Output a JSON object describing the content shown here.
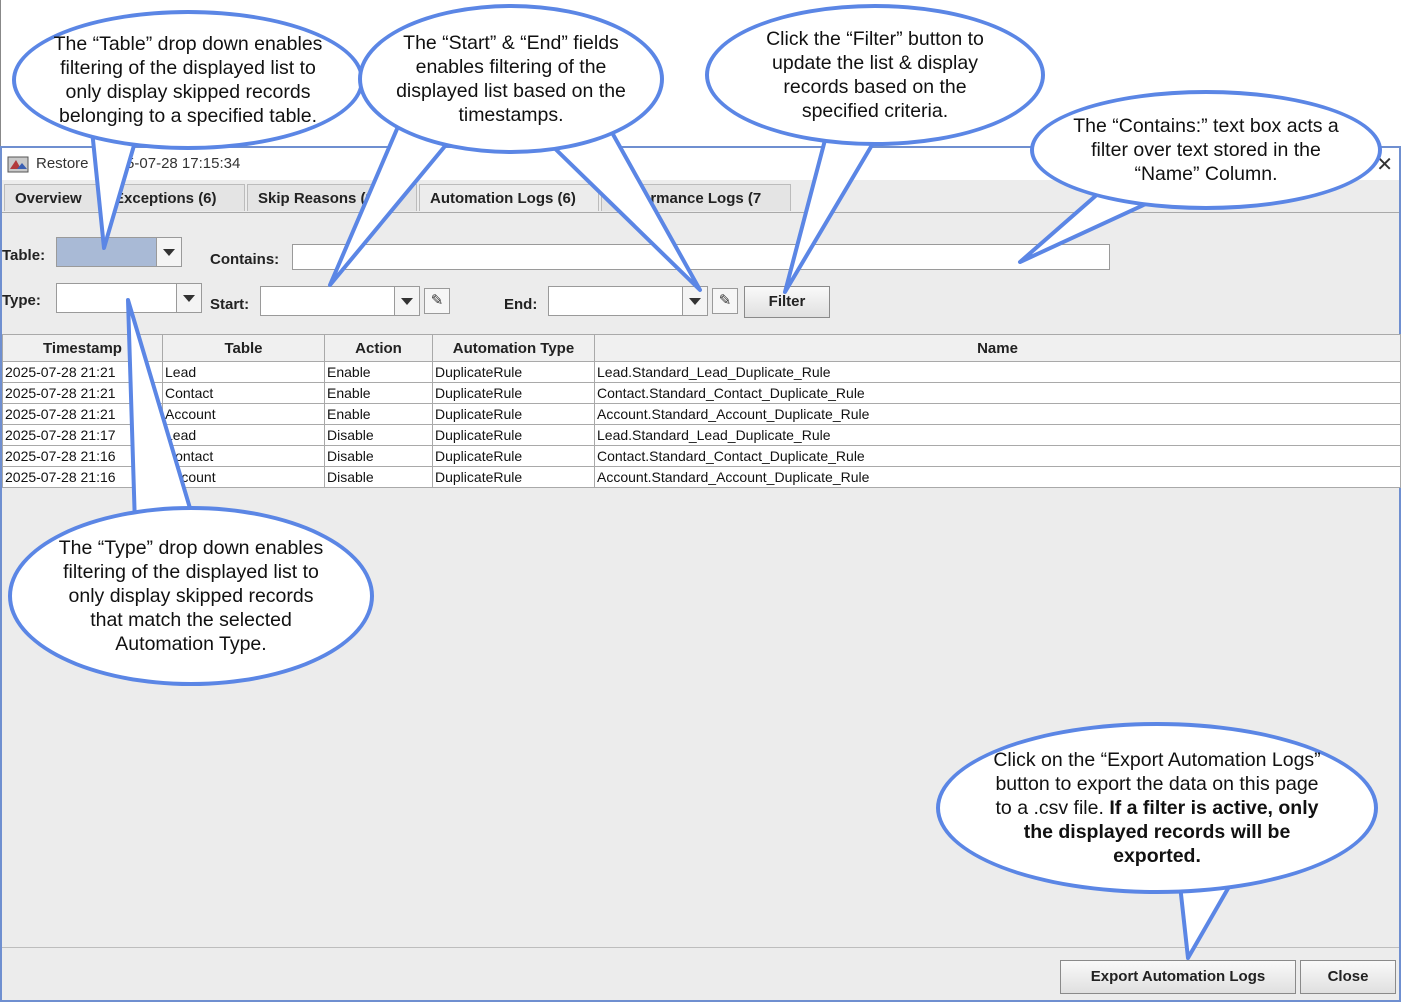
{
  "window": {
    "title": "Restore  : 2025-07-28 17:15:34",
    "close_glyph": "✕"
  },
  "tabs": [
    {
      "label": "Overview"
    },
    {
      "label": "Exceptions (6)"
    },
    {
      "label": "Skip Reasons (8"
    },
    {
      "label": "Automation Logs (6)"
    },
    {
      "label": "Performance Logs (7"
    }
  ],
  "filters": {
    "table_label": "Table:",
    "contains_label": "Contains:",
    "type_label": "Type:",
    "start_label": "Start:",
    "end_label": "End:",
    "filter_button": "Filter",
    "table_selected_color": "#a9bad6"
  },
  "grid": {
    "columns": [
      "Timestamp",
      "Table",
      "Action",
      "Automation Type",
      "Name"
    ],
    "rows": [
      [
        "2025-07-28 21:21",
        "Lead",
        "Enable",
        "DuplicateRule",
        "Lead.Standard_Lead_Duplicate_Rule"
      ],
      [
        "2025-07-28 21:21",
        "Contact",
        "Enable",
        "DuplicateRule",
        "Contact.Standard_Contact_Duplicate_Rule"
      ],
      [
        "2025-07-28 21:21",
        "Account",
        "Enable",
        "DuplicateRule",
        "Account.Standard_Account_Duplicate_Rule"
      ],
      [
        "2025-07-28 21:17",
        "Lead",
        "Disable",
        "DuplicateRule",
        "Lead.Standard_Lead_Duplicate_Rule"
      ],
      [
        "2025-07-28 21:16",
        "Contact",
        "Disable",
        "DuplicateRule",
        "Contact.Standard_Contact_Duplicate_Rule"
      ],
      [
        "2025-07-28 21:16",
        "Account",
        "Disable",
        "DuplicateRule",
        "Account.Standard_Account_Duplicate_Rule"
      ]
    ]
  },
  "buttons": {
    "export": "Export Automation Logs",
    "close": "Close"
  },
  "callouts": {
    "table_dd": [
      "The “Table” drop down enables",
      "filtering of the displayed list to",
      "only display skipped records",
      "belonging to a specified table."
    ],
    "start_end": [
      "The “Start” & “End” fields",
      "enables filtering of the",
      "displayed list based on the",
      "timestamps."
    ],
    "filter_btn": [
      "Click the “Filter” button to",
      "update the list & display",
      "records based on the",
      "specified criteria."
    ],
    "contains": [
      "The “Contains:” text box acts a",
      "filter over text stored in the",
      "“Name” Column."
    ],
    "type_dd": [
      "The “Type” drop down enables",
      "filtering of the displayed list to",
      "only display skipped records",
      "that match the selected",
      "Automation Type."
    ],
    "export": {
      "lines": [
        "Click on the “Export Automation Logs”",
        "button to export the data on this page"
      ],
      "line3_plain": "to a .csv file. ",
      "line3_bold": "If a filter is active, only",
      "bold_lines": [
        "the displayed records will be",
        "exported."
      ]
    }
  },
  "colors": {
    "callout_border": "#5b86e5",
    "window_border": "#6f8fd0"
  }
}
